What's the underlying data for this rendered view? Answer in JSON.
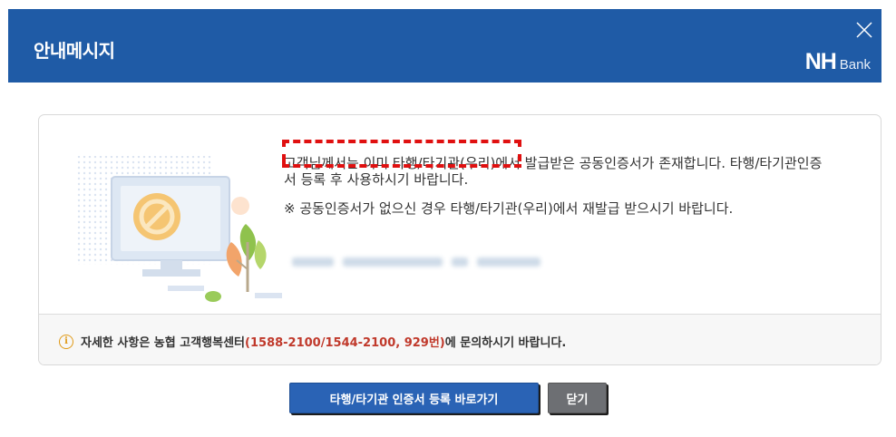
{
  "dialog": {
    "title": "안내메시지",
    "brand_nh": "NH",
    "brand_bank": "Bank"
  },
  "message": {
    "line1": "고객님께서는 이미 타행/타기관(우리)에서 발급받은 공동인증서가 존재합니다. 타행/타기관인증서 등록 후 사용하시기 바랍니다.",
    "line2": "※ 공동인증서가 없으신 경우 타행/타기관(우리)에서 재발급 받으시기 바랍니다."
  },
  "footer": {
    "prefix": "자세한 사항은 농협 고객행복센터",
    "phone": "(1588-2100/1544-2100, 929번)",
    "suffix": "에 문의하시기 바랍니다."
  },
  "buttons": {
    "register_label": "타행/타기관 인증서 등록 바로가기",
    "close_label": "닫기"
  },
  "colors": {
    "header_bg": "#1f5ba6",
    "primary_button": "#2a63b5",
    "secondary_button": "#6d6f73",
    "highlight_dash": "#e01010",
    "phone_text": "#c0392b"
  },
  "icons": [
    "close-icon",
    "info-icon",
    "prohibited-icon"
  ]
}
